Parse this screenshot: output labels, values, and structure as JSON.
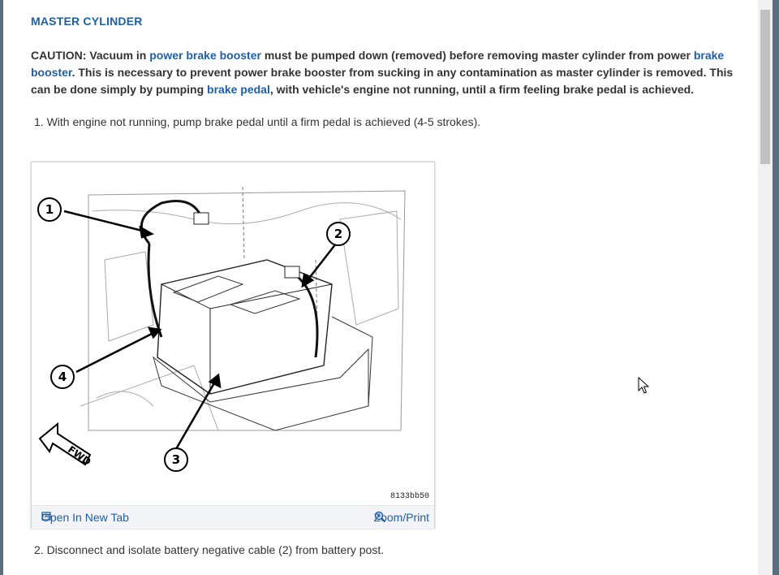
{
  "section": {
    "title": "MASTER CYLINDER"
  },
  "caution": {
    "label": "CAUTION:",
    "t1": " Vacuum in ",
    "link1": "power brake booster",
    "t2": " must be pumped down (removed) before removing master cylinder from power ",
    "link2": "brake booster",
    "t3": ". This is necessary to prevent power brake booster from sucking in any contamination as master cylinder is removed. This can be done simply by pumping ",
    "link3": "brake pedal",
    "t4": ", with vehicle's engine not running, until a firm feeling brake pedal is achieved."
  },
  "steps": [
    "1. With engine not running, pump brake pedal until a firm pedal is achieved (4-5 strokes).",
    "2. Disconnect and isolate battery negative cable (2) from battery post."
  ],
  "figure": {
    "code": "8133bb50",
    "callouts": [
      "1",
      "2",
      "3",
      "4"
    ],
    "fwd_label": "FWD",
    "open_tab_label": "Open In New Tab",
    "zoom_label": "Zoom/Print",
    "open_icon": "open-in-new-tab-icon",
    "zoom_icon": "magnifier-plus-icon"
  },
  "colors": {
    "link": "#1f5fa8",
    "text": "#333333",
    "toolbar_bg": "#f2f4f7"
  }
}
